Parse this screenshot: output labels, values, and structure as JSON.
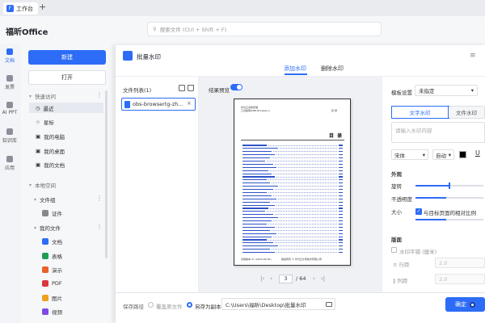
{
  "tabbar": {
    "tab_label": "工作台",
    "add": "+"
  },
  "header": {
    "brand": "福昕Office",
    "search_placeholder": "搜索文件 (Ctrl + Shift + F)"
  },
  "rail": [
    {
      "label": "文档",
      "icon": "document-icon",
      "active": true
    },
    {
      "label": "发票",
      "icon": "invoice-icon"
    },
    {
      "label": "AI PPT",
      "icon": "ai-ppt-icon"
    },
    {
      "label": "知识库",
      "icon": "knowledge-base-icon"
    },
    {
      "label": "应用",
      "icon": "apps-icon"
    }
  ],
  "panel": {
    "new_label": "新建",
    "open_label": "打开",
    "quick_access": "快速访问",
    "recent": "最近",
    "starred": "星标",
    "my_computer": "我的电脑",
    "my_desktop": "我的桌面",
    "my_docs": "我的文档",
    "local_space": "本地空间",
    "docs_group": "文件组",
    "certificates": "证件",
    "my_files": "我的文件",
    "file_types": [
      "文档",
      "表格",
      "演示",
      "PDF",
      "图片",
      "视频"
    ]
  },
  "dialog": {
    "title": "批量水印",
    "tab_add": "添加水印",
    "tab_remove": "删除水印",
    "filelist_title": "文件列表(1)",
    "file_name": "obs-browsertg-zh...",
    "close": "×",
    "preview_label": "结果预览",
    "page_title_small_1": "华为云对象存储",
    "page_title_small_2": "工具指南(OBS Browser+)",
    "page_num_top": "目 录",
    "toc_heading": "目 录",
    "footer_left": "文档版本 27 (2023-09-30)",
    "footer_right": "版权所有 © 华为云计算技术有限公司",
    "pager_first": "|‹",
    "pager_prev": "‹",
    "pager_next": "›",
    "pager_last": "›|",
    "current_page": "3",
    "total_pages": "/ 64",
    "template_label": "模板设置",
    "template_value": "未指定",
    "seg_text": "文字水印",
    "seg_file": "文件水印",
    "wm_placeholder": "请输入水印内容",
    "font": "宋体",
    "size": "自动",
    "underline": "U",
    "appearance": "外观",
    "rotate": "旋转",
    "opacity": "不透明度",
    "scale": "大小",
    "ratio_label": "与目标页面的相对比例",
    "layout": "版面",
    "tile_label": "水印平铺 (厘米)",
    "row_spacing": "行距",
    "col_spacing": "列距",
    "row_value": "2.0",
    "col_value": "2.0",
    "save_path_label": "保存路径",
    "overwrite": "覆盖原文件",
    "save_copy": "另存为副本",
    "path_value": "C:\\Users\\福昕\\Desktop\\批量水印",
    "ok": "确定"
  },
  "colors": {
    "accent": "#2d6cf6",
    "link": "#2d52c8"
  }
}
